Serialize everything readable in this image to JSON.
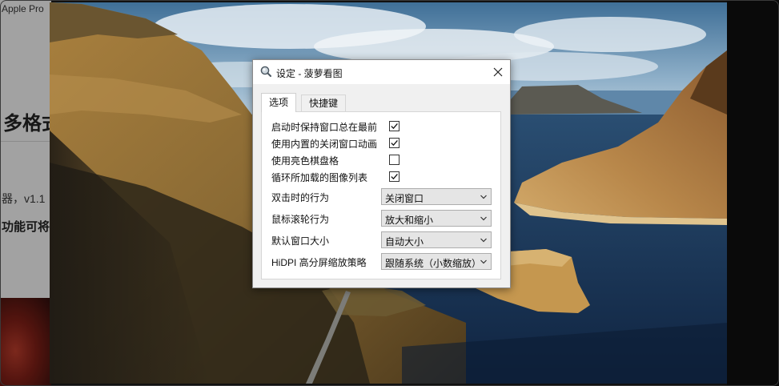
{
  "background_page": {
    "line1": "Apple Pro",
    "line2": "多格式",
    "line3": "器，v1.1",
    "line4": "功能可将"
  },
  "dialog": {
    "title": "设定 - 菠萝看图",
    "app_icon": "magnifier-app-icon",
    "close_icon": "close-icon",
    "tabs": [
      {
        "label": "选项",
        "active": true
      },
      {
        "label": "快捷键",
        "active": false
      }
    ],
    "options": [
      {
        "label": "启动时保持窗口总在最前",
        "checked": true
      },
      {
        "label": "使用内置的关闭窗口动画",
        "checked": true
      },
      {
        "label": "使用亮色棋盘格",
        "checked": false
      },
      {
        "label": "循环所加载的图像列表",
        "checked": true
      }
    ],
    "selects": [
      {
        "label": "双击时的行为",
        "value": "关闭窗口"
      },
      {
        "label": "鼠标滚轮行为",
        "value": "放大和缩小"
      },
      {
        "label": "默认窗口大小",
        "value": "自动大小"
      },
      {
        "label": "HiDPI 高分屏缩放策略",
        "value": "跟随系统（小数缩放）"
      }
    ]
  },
  "colors": {
    "dialog_bg": "#f0f0f0",
    "panel_bg": "#ffffff",
    "select_bg": "#e5e5e5"
  }
}
